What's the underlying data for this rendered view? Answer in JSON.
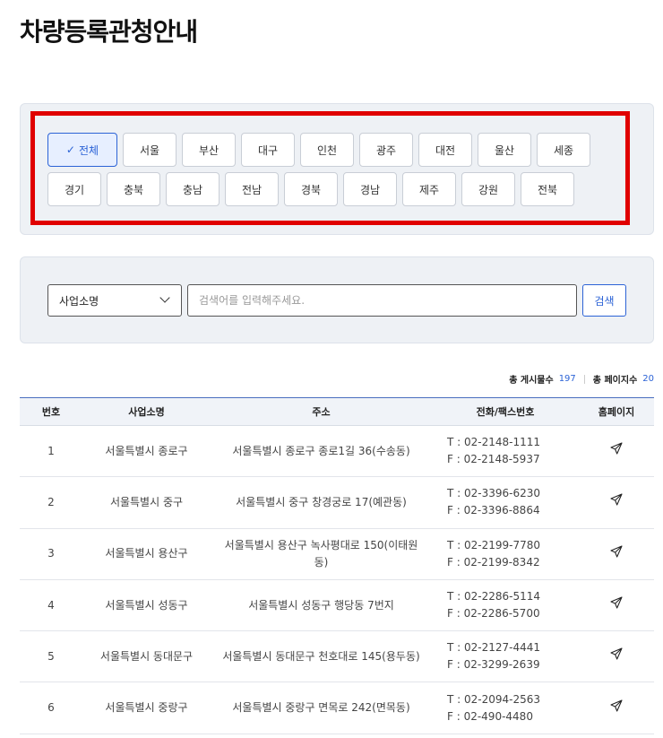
{
  "page": {
    "title": "차량등록관청안내"
  },
  "regions": {
    "row1": [
      "전체",
      "서울",
      "부산",
      "대구",
      "인천",
      "광주",
      "대전",
      "울산",
      "세종"
    ],
    "row2": [
      "경기",
      "충북",
      "충남",
      "전남",
      "경북",
      "경남",
      "제주",
      "강원",
      "전북"
    ],
    "selected": "전체",
    "check_icon": "check-icon"
  },
  "search": {
    "select_value": "사업소명",
    "placeholder": "검색어를 입력해주세요.",
    "button_label": "검색"
  },
  "summary": {
    "total_posts_label": "총 게시물수",
    "total_posts": "197",
    "total_pages_label": "총 페이지수",
    "total_pages": "20"
  },
  "table": {
    "headers": [
      "번호",
      "사업소명",
      "주소",
      "전화/팩스번호",
      "홈페이지"
    ],
    "home_icon": "paper-plane-icon",
    "rows": [
      {
        "no": "1",
        "name": "서울특별시 종로구",
        "address": "서울특별시 종로구 종로1길 36(수송동)",
        "tel": "T : 02-2148-1111",
        "fax": "F : 02-2148-5937"
      },
      {
        "no": "2",
        "name": "서울특별시 중구",
        "address": "서울특별시 중구 창경궁로 17(예관동)",
        "tel": "T : 02-3396-6230",
        "fax": "F : 02-3396-8864"
      },
      {
        "no": "3",
        "name": "서울특별시 용산구",
        "address": "서울특별시 용산구 녹사평대로 150(이태원동)",
        "tel": "T : 02-2199-7780",
        "fax": "F : 02-2199-8342"
      },
      {
        "no": "4",
        "name": "서울특별시 성동구",
        "address": "서울특별시 성동구 행당동 7번지",
        "tel": "T : 02-2286-5114",
        "fax": "F : 02-2286-5700"
      },
      {
        "no": "5",
        "name": "서울특별시 동대문구",
        "address": "서울특별시 동대문구 천호대로 145(용두동)",
        "tel": "T : 02-2127-4441",
        "fax": "F : 02-3299-2639"
      },
      {
        "no": "6",
        "name": "서울특별시 중랑구",
        "address": "서울특별시 중랑구 면목로 242(면목동)",
        "tel": "T : 02-2094-2563",
        "fax": "F : 02-490-4480"
      }
    ]
  }
}
